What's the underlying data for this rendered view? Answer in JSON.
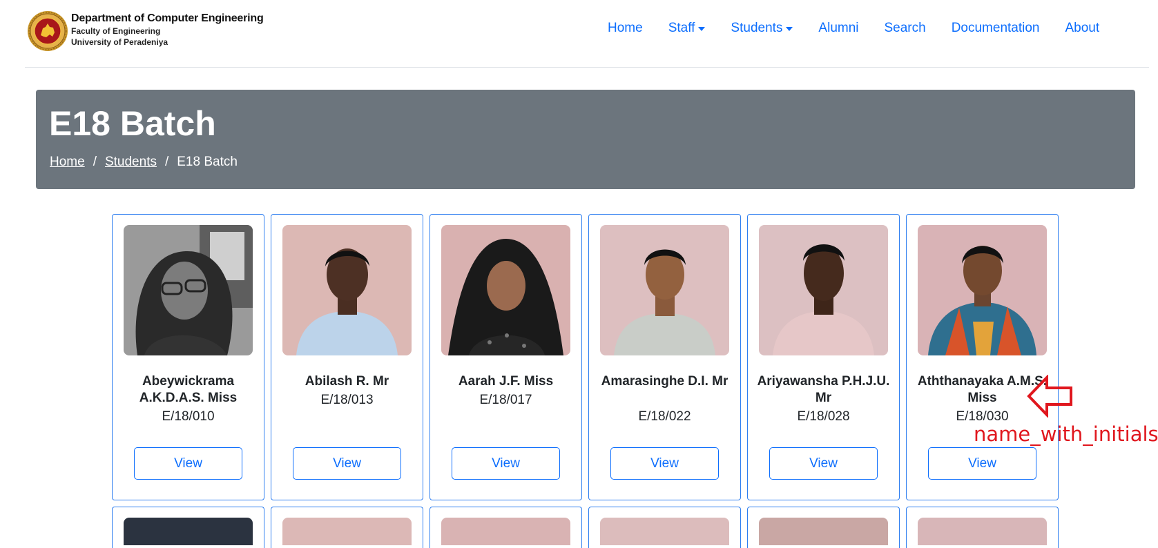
{
  "brand": {
    "title": "Department of  Computer Engineering",
    "faculty": "Faculty of Engineering",
    "university": "University of Peradeniya"
  },
  "nav": [
    {
      "label": "Home",
      "dropdown": false
    },
    {
      "label": "Staff",
      "dropdown": true
    },
    {
      "label": "Students",
      "dropdown": true
    },
    {
      "label": "Alumni",
      "dropdown": false
    },
    {
      "label": "Search",
      "dropdown": false
    },
    {
      "label": "Documentation",
      "dropdown": false
    },
    {
      "label": "About",
      "dropdown": false
    }
  ],
  "header": {
    "title": "E18 Batch",
    "breadcrumb": [
      "Home",
      "Students",
      "E18 Batch"
    ],
    "breadcrumb_separator": "/"
  },
  "students": [
    {
      "name": "Abeywickrama A.K.D.A.S. Miss",
      "reg_no": "E/18/010",
      "button": "View"
    },
    {
      "name": "Abilash R. Mr",
      "reg_no": "E/18/013",
      "button": "View"
    },
    {
      "name": "Aarah J.F. Miss",
      "reg_no": "E/18/017",
      "button": "View"
    },
    {
      "name": "Amarasinghe D.I. Mr",
      "reg_no": "E/18/022",
      "button": "View"
    },
    {
      "name": "Ariyawansha P.H.J.U. Mr",
      "reg_no": "E/18/028",
      "button": "View"
    },
    {
      "name": "Aththanayaka A.M.S. Miss",
      "reg_no": "E/18/030",
      "button": "View"
    }
  ],
  "annotation": {
    "label": "name_with_initials",
    "color": "#e0171e"
  },
  "colors": {
    "primary": "#0d6efd",
    "banner": "#6c757d",
    "card_border": "#2f7ff0"
  }
}
